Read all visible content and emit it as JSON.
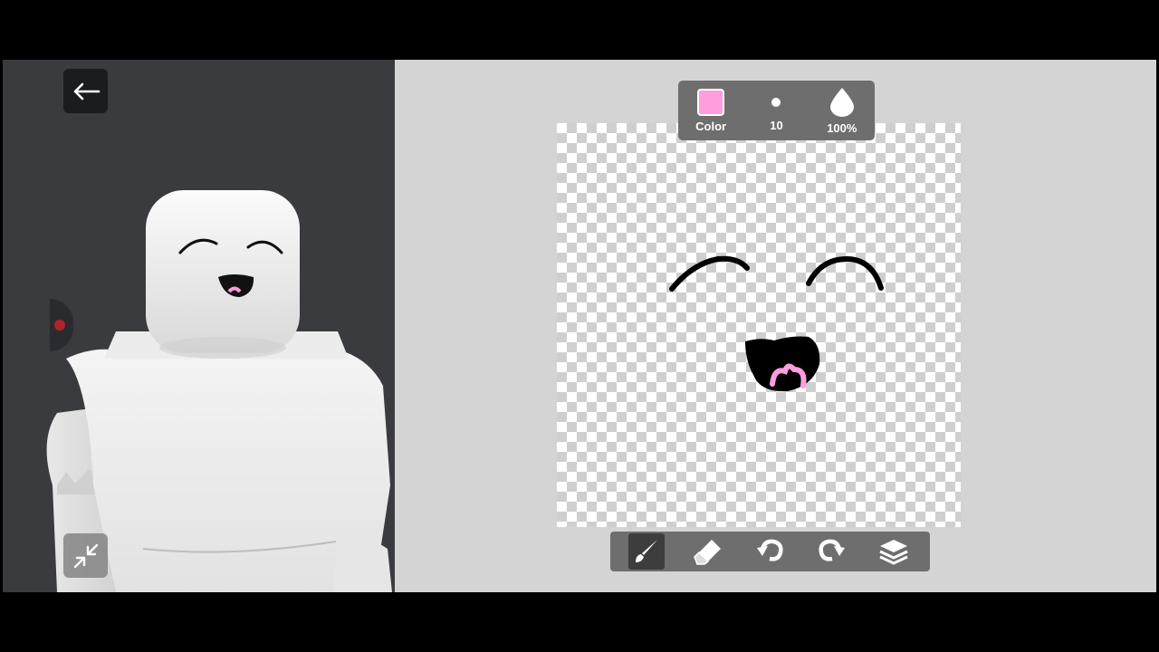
{
  "editor": {
    "toolbar": {
      "color_label": "Color",
      "color_value": "#ff9ddd",
      "brush_size": "10",
      "opacity": "100%"
    },
    "tools": [
      {
        "name": "brush",
        "icon": "brush-icon",
        "active": true
      },
      {
        "name": "eraser",
        "icon": "eraser-icon",
        "active": false
      },
      {
        "name": "undo",
        "icon": "undo-icon",
        "active": false
      },
      {
        "name": "redo",
        "icon": "redo-icon",
        "active": false
      },
      {
        "name": "layers",
        "icon": "layers-icon",
        "active": false
      }
    ]
  },
  "preview": {
    "back_icon": "arrow-left-icon",
    "minimize_icon": "minimize-icon",
    "record_indicator_color": "#b0232b"
  },
  "colors": {
    "panel_bg": "#393b3f",
    "editor_bg": "#d4d4d4",
    "toolbar_bg": "#6e6e6e",
    "accent_pink": "#ff9ddd"
  }
}
